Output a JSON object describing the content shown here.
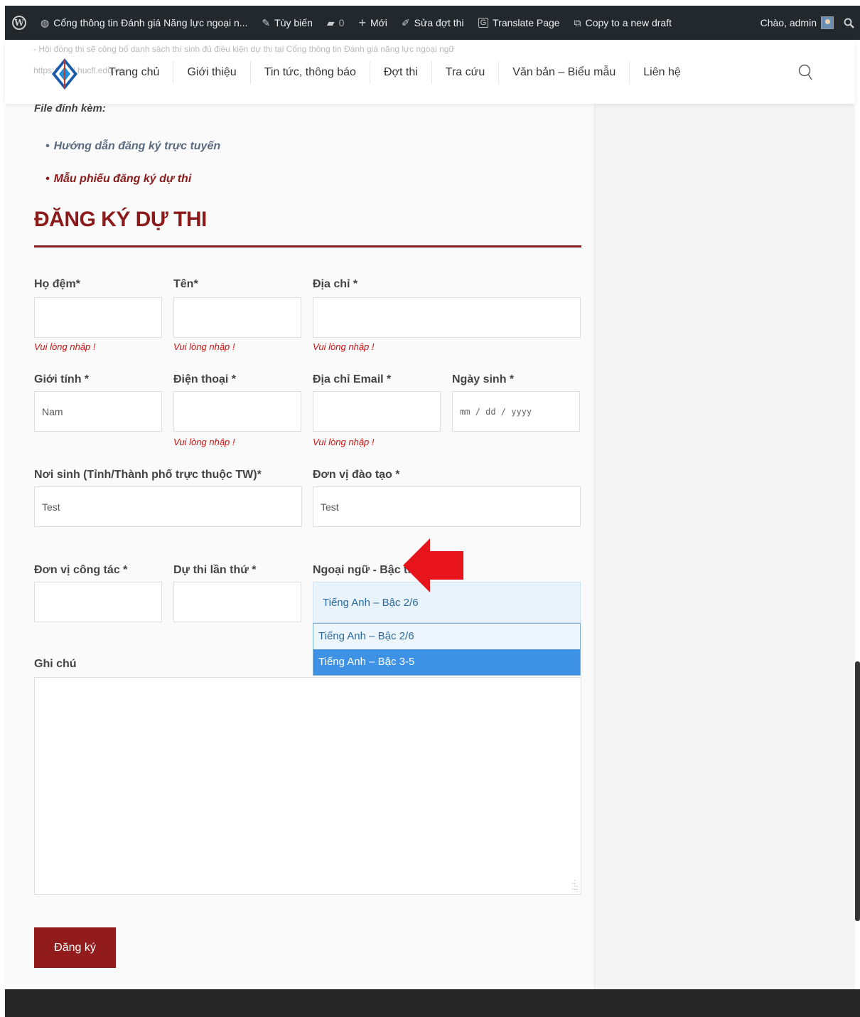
{
  "adminbar": {
    "site_title": "Cổng thông tin Đánh giá Năng lực ngoại n...",
    "customize": "Tùy biến",
    "comments_count": "0",
    "new": "Mới",
    "edit": "Sửa đợt thi",
    "translate": "Translate Page",
    "copy_draft": "Copy to a new draft",
    "greeting": "Chào, admin"
  },
  "nav": {
    "bleed_text_1": "- Hội đồng thi sẽ công bố danh sách thí sinh đủ điều kiện dự thi tại Cổng thông tin Đánh giá năng lực ngoại ngữ",
    "bleed_text_2": "https://dgnl.hucfl.edu.vn",
    "items": [
      "Trang chủ",
      "Giới thiệu",
      "Tin tức, thông báo",
      "Đợt thi",
      "Tra cứu",
      "Văn bản – Biểu mẫu",
      "Liên hệ"
    ]
  },
  "attachments": {
    "label": "File đính kèm:",
    "items": [
      "Hướng dẫn đăng ký trực tuyến",
      "Mẫu phiếu đăng ký dự thi"
    ]
  },
  "form": {
    "title": "ĐĂNG KÝ DỰ THI",
    "required_error": "Vui lòng nhập !",
    "fields": {
      "ho_dem": {
        "label": "Họ đệm*",
        "value": ""
      },
      "ten": {
        "label": "Tên*",
        "value": ""
      },
      "dia_chi": {
        "label": "Địa chỉ *",
        "value": ""
      },
      "gioi_tinh": {
        "label": "Giới tính *",
        "value": "Nam"
      },
      "dien_thoai": {
        "label": "Điện thoại *",
        "value": ""
      },
      "email": {
        "label": "Địa chỉ Email *",
        "value": ""
      },
      "ngay_sinh": {
        "label": "Ngày sinh *",
        "placeholder": "mm / dd / yyyy"
      },
      "noi_sinh": {
        "label": "Nơi sinh (Tỉnh/Thành phố trực thuộc TW)*",
        "value": "Test"
      },
      "don_vi_dao_tao": {
        "label": "Đơn vị đào tạo *",
        "value": "Test"
      },
      "don_vi_cong_tac": {
        "label": "Đơn vị công tác *",
        "value": ""
      },
      "du_thi_lan_thu": {
        "label": "Dự thi lần thứ *",
        "value": ""
      },
      "ngoai_ngu": {
        "label": "Ngoại ngữ - Bậc thi *",
        "selected": "Tiếng Anh – Bậc 2/6",
        "options": [
          "Tiếng Anh – Bậc 2/6",
          "Tiếng Anh – Bậc 3-5"
        ],
        "highlighted_index": 1
      },
      "ghi_chu": {
        "label": "Ghi chú",
        "value": ""
      }
    },
    "submit_label": "Đăng ký"
  },
  "colors": {
    "accent": "#8b1a1a",
    "error": "#d01010",
    "highlight": "#3d92e6",
    "annotation_arrow": "#e8141c"
  }
}
